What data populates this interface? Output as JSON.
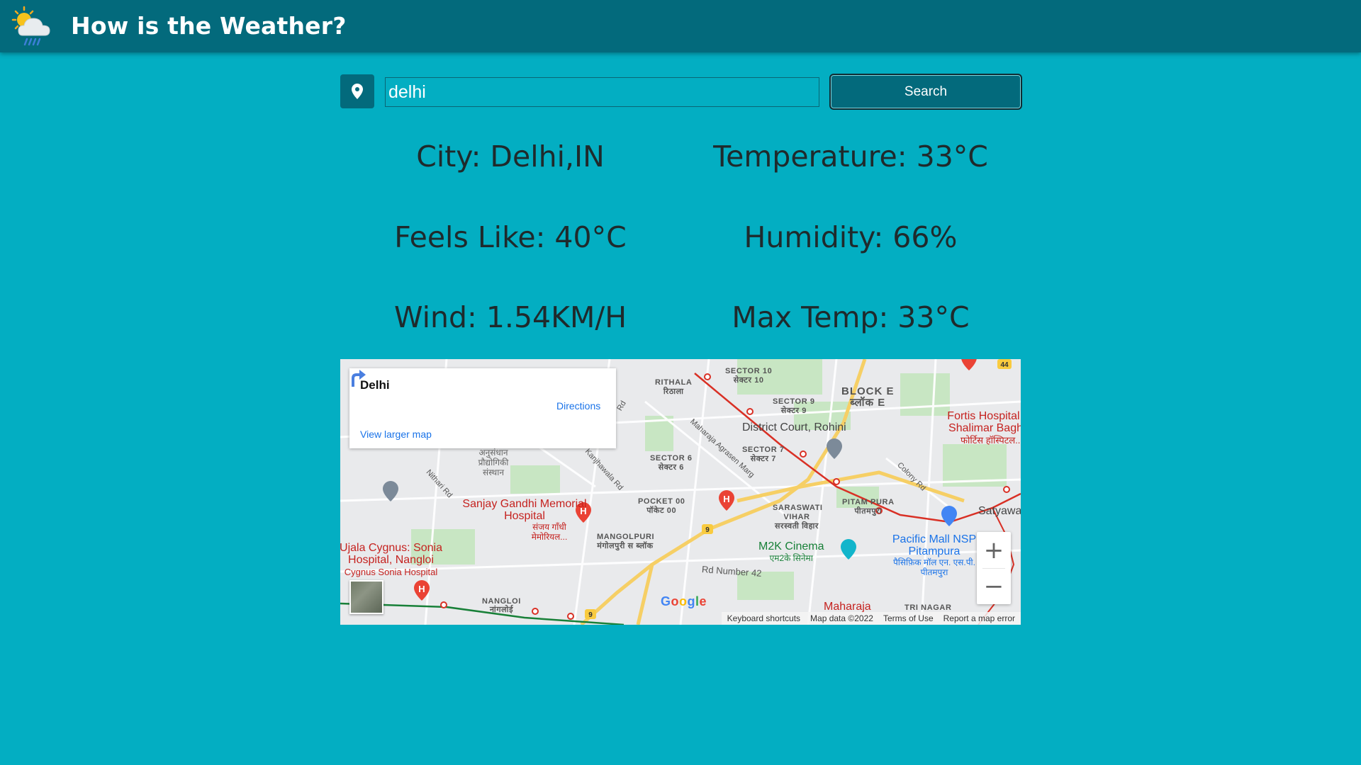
{
  "app": {
    "title": "How is the Weather?",
    "logo_icon": "weather-cloud-sun-rain-icon"
  },
  "search": {
    "location_icon": "map-pin-icon",
    "value": "delhi",
    "button_label": "Search"
  },
  "weather": {
    "city": "City: Delhi,IN",
    "temperature": "Temperature: 33°C",
    "feels_like": "Feels Like: 40°C",
    "humidity": "Humidity: 66%",
    "wind": "Wind: 1.54KM/H",
    "max_temp": "Max Temp: 33°C"
  },
  "map": {
    "place_name": "Delhi",
    "directions_label": "Directions",
    "view_larger_label": "View larger map",
    "zoom_in": "+",
    "zoom_out": "−",
    "google_logo": "Google",
    "footer": {
      "shortcuts": "Keyboard shortcuts",
      "map_data": "Map data ©2022",
      "terms": "Terms of Use",
      "report": "Report a map error"
    },
    "labels": {
      "rithala": "RITHALA",
      "rithala_hi": "रिठाला",
      "sector10": "SECTOR 10",
      "sector10_hi": "सेक्टर 10",
      "sector9": "SECTOR 9",
      "sector9_hi": "सेक्टर 9",
      "block_e": "BLOCK E",
      "block_e_hi": "ब्लॉक E",
      "district_court": "District Court, Rohini",
      "fortis": "Fortis Hospital, Shalimar Bagh",
      "fortis_hi": "फोर्टिस हॉस्पिटल...",
      "sector7": "SECTOR 7",
      "sector7_hi": "सेक्टर 7",
      "sector6": "SECTOR 6",
      "sector6_hi": "सेक्टर 6",
      "institute_hi": "अनुसंधान प्रौद्योगिकी संस्थान",
      "kanjhawala_rd": "Kanjhawala Rd",
      "maharaja_agrasen": "Maharaja Agrasen Marg",
      "colony_rd": "Colony Rd",
      "nithari_rd": "Nithari Rd",
      "sanjay_gandhi": "Sanjay Gandhi Memorial Hospital",
      "sanjay_gandhi_hi": "संजय गाँधी मेमोरियल...",
      "pocket00": "POCKET 00",
      "pocket00_hi": "पॉकेट 00",
      "saraswati_vihar": "SARASWATI VIHAR",
      "saraswati_vihar_hi": "सरस्वती विहार",
      "pitam_pura": "PITAM PURA",
      "pitam_pura_hi": "पीतमपुरा",
      "satyawati": "Satyawa",
      "mangolpuri": "MANGOLPURI",
      "mangolpuri_hi": "मंगोलपुरी स ब्लॉक",
      "m2k": "M2K Cinema",
      "m2k_hi": "एम2के सिनेमा",
      "pacific_mall": "Pacific Mall NSP Pitampura",
      "pacific_mall_hi": "पैसिफ़िक मॉल एन. एस.पी. पीतमपुरा",
      "ujala": "Ujala Cygnus: Sonia Hospital, Nangloi",
      "ujala_sub": "Cygnus Sonia Hospital",
      "rd_number_42": "Rd Number 42",
      "nangloi": "NANGLOI",
      "nangloi_hi": "नांगलोई",
      "maharaja": "Maharaja",
      "tri_nagar": "TRI NAGAR",
      "road_9": "9",
      "road_44": "44",
      "road_rd": "Rd"
    }
  }
}
